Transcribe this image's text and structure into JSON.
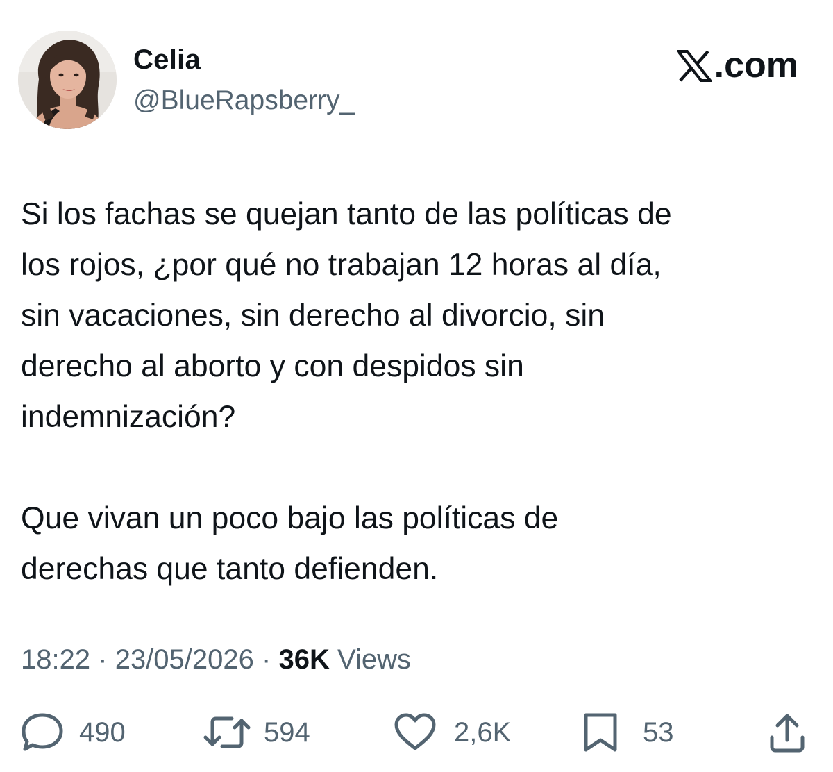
{
  "author": {
    "name": "Celia",
    "handle": "@BlueRapsberry_"
  },
  "brand": {
    "icon": "x-logo-icon",
    "label": ".com"
  },
  "tweet": {
    "text": "Si los fachas se quejan tanto de las políticas de\nlos rojos, ¿por qué no trabajan 12 horas al día,\nsin vacaciones, sin derecho al divorcio, sin\nderecho al aborto y con despidos sin\nindemnización?\n\nQue vivan un poco bajo las políticas de\nderechas que tanto defienden."
  },
  "meta": {
    "time": "18:22",
    "separator": "·",
    "date": "23/05/2026",
    "views_count": "36K",
    "views_label": "Views"
  },
  "actions": {
    "replies": {
      "icon": "reply-icon",
      "count": "490"
    },
    "reposts": {
      "icon": "repost-icon",
      "count": "594"
    },
    "likes": {
      "icon": "heart-icon",
      "count": "2,6K"
    },
    "bookmarks": {
      "icon": "bookmark-icon",
      "count": "53"
    },
    "share": {
      "icon": "share-icon"
    }
  },
  "colors": {
    "text_primary": "#0f1419",
    "text_secondary": "#536471",
    "background": "#ffffff"
  }
}
